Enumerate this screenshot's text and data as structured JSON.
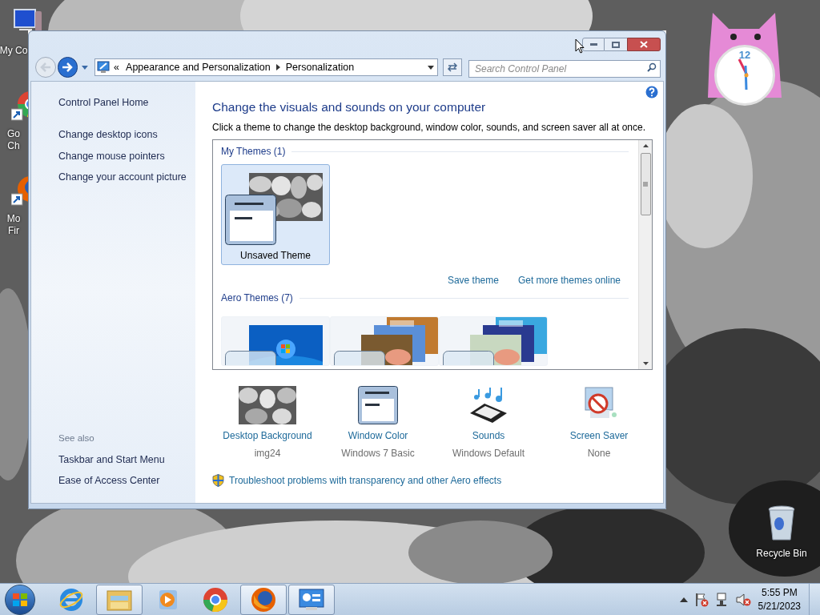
{
  "desktop": {
    "left_icons": [
      {
        "kind": "computer",
        "lines": [
          "My Co"
        ]
      },
      {
        "kind": "chrome",
        "lines": [
          "Go",
          "Ch"
        ]
      },
      {
        "kind": "firefox",
        "lines": [
          "Mo",
          "Fir"
        ]
      }
    ],
    "recycle_bin": {
      "label": "Recycle Bin"
    }
  },
  "clock_gadget": {
    "numeral": "12"
  },
  "window": {
    "nav": {
      "back": {
        "disabled": true
      },
      "forward": {
        "disabled": false
      }
    },
    "address": {
      "overflow_mark": "«",
      "crumbs": [
        "Appearance and Personalization",
        "Personalization"
      ]
    },
    "search": {
      "placeholder": "Search Control Panel"
    },
    "sidebar": {
      "home": "Control Panel Home",
      "links": [
        "Change desktop icons",
        "Change mouse pointers",
        "Change your account picture"
      ],
      "see_also": {
        "title": "See also",
        "links": [
          "Taskbar and Start Menu",
          "Ease of Access Center"
        ]
      }
    },
    "main": {
      "heading": "Change the visuals and sounds on your computer",
      "description": "Click a theme to change the desktop background, window color, sounds, and screen saver all at once.",
      "theme_groups": [
        {
          "title": "My Themes (1)",
          "themes": [
            {
              "kind": "custom",
              "label": "Unsaved Theme",
              "selected": true
            }
          ],
          "links": [
            "Save theme",
            "Get more themes online"
          ]
        },
        {
          "title": "Aero Themes (7)",
          "themes": [
            {
              "kind": "windows7",
              "selected": false
            },
            {
              "kind": "landscapes",
              "selected": false
            },
            {
              "kind": "nature",
              "selected": false
            }
          ]
        }
      ],
      "settings": [
        {
          "kind": "background",
          "label": "Desktop Background",
          "value": "img24"
        },
        {
          "kind": "color",
          "label": "Window Color",
          "value": "Windows 7 Basic"
        },
        {
          "kind": "sounds",
          "label": "Sounds",
          "value": "Windows Default"
        },
        {
          "kind": "screensaver",
          "label": "Screen Saver",
          "value": "None"
        }
      ],
      "troubleshoot": "Troubleshoot problems with transparency and other Aero effects"
    }
  },
  "taskbar": {
    "apps": [
      {
        "kind": "ie",
        "running": false
      },
      {
        "kind": "explorer",
        "running": true
      },
      {
        "kind": "media",
        "running": false
      },
      {
        "kind": "chrome",
        "running": false
      },
      {
        "kind": "firefox",
        "running": true
      },
      {
        "kind": "control_panel",
        "running": true
      }
    ],
    "clock": {
      "time": "5:55 PM",
      "date": "5/21/2023"
    }
  }
}
